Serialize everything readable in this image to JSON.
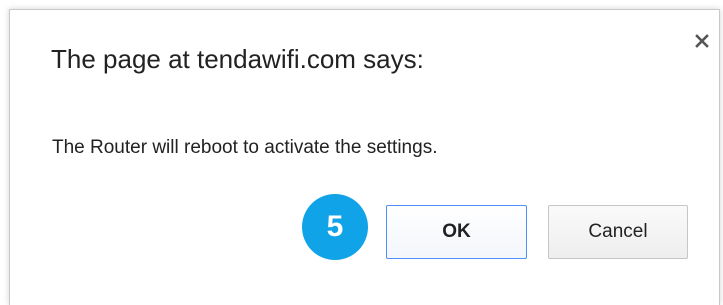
{
  "dialog": {
    "title": "The page at tendawifi.com says:",
    "message": "The Router will reboot to activate the settings.",
    "close_icon": "close-icon",
    "step_badge": "5",
    "ok_label": "OK",
    "cancel_label": "Cancel"
  },
  "colors": {
    "badge": "#11a3e8",
    "ok_border": "#4d90fe",
    "text": "#222222"
  }
}
